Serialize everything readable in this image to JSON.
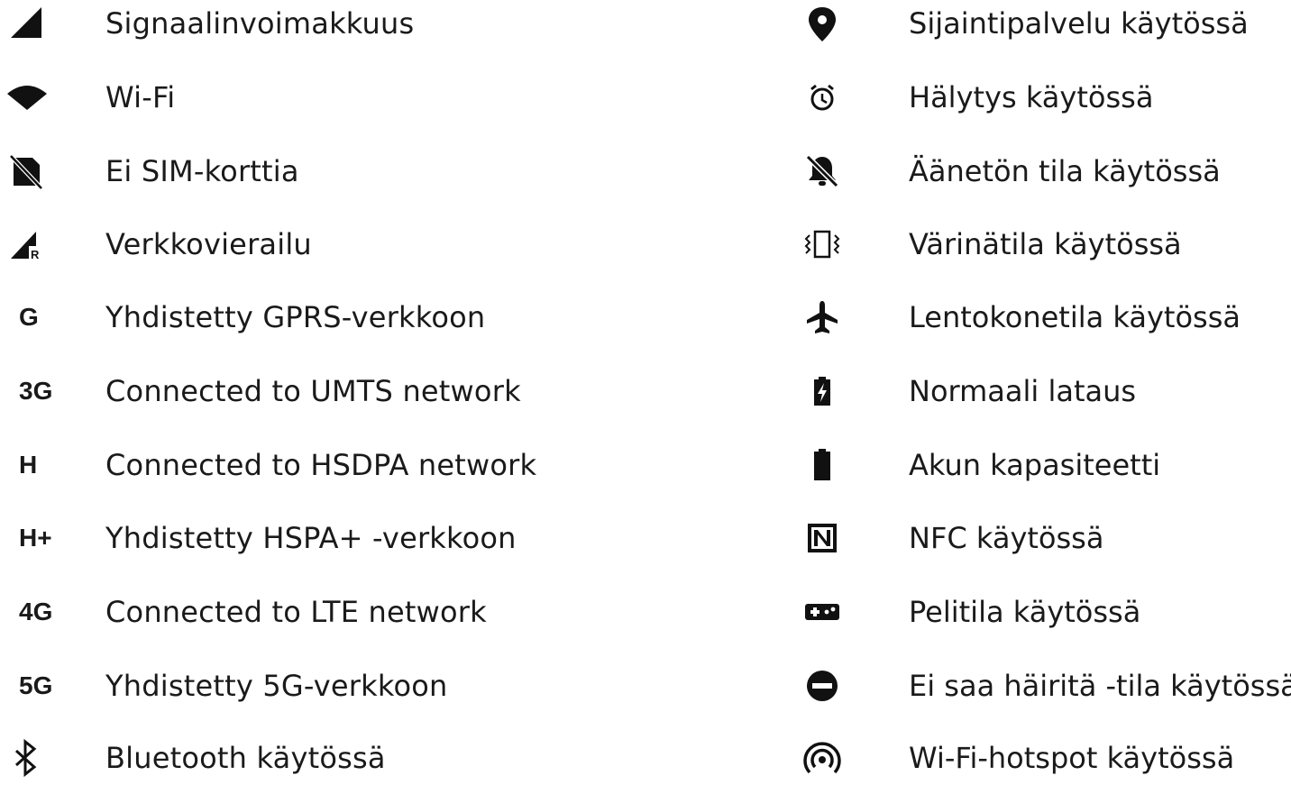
{
  "left_items": [
    {
      "icon": "signal-strength-icon",
      "label": "Signaalinvoimakkuus"
    },
    {
      "icon": "wifi-icon",
      "label": "Wi-Fi"
    },
    {
      "icon": "no-sim-icon",
      "label": "Ei SIM-korttia"
    },
    {
      "icon": "roaming-icon",
      "label": "Verkkovierailu"
    },
    {
      "icon": "gprs-icon",
      "icon_text": "G",
      "label": "Yhdistetty GPRS-verkkoon"
    },
    {
      "icon": "umts-icon",
      "icon_text": "3G",
      "label": "Connected to UMTS network"
    },
    {
      "icon": "hsdpa-icon",
      "icon_text": "H",
      "label": "Connected to HSDPA network"
    },
    {
      "icon": "hspa-plus-icon",
      "icon_text": "H+",
      "label": "Yhdistetty HSPA+ -verkkoon"
    },
    {
      "icon": "lte-icon",
      "icon_text": "4G",
      "label": "Connected to LTE network"
    },
    {
      "icon": "5g-icon",
      "icon_text": "5G",
      "label": "Yhdistetty 5G-verkkoon"
    },
    {
      "icon": "bluetooth-icon",
      "label": "Bluetooth käytössä"
    }
  ],
  "right_items": [
    {
      "icon": "location-icon",
      "label": "Sijaintipalvelu käytössä"
    },
    {
      "icon": "alarm-icon",
      "label": "Hälytys käytössä"
    },
    {
      "icon": "silent-bell-icon",
      "label": "Äänetön tila käytössä"
    },
    {
      "icon": "vibrate-icon",
      "label": "Värinätila käytössä"
    },
    {
      "icon": "airplane-icon",
      "label": "Lentokonetila käytössä"
    },
    {
      "icon": "battery-charging-icon",
      "label": "Normaali lataus"
    },
    {
      "icon": "battery-full-icon",
      "label": "Akun kapasiteetti"
    },
    {
      "icon": "nfc-icon",
      "label": "NFC käytössä"
    },
    {
      "icon": "game-mode-icon",
      "label": "Pelitila käytössä"
    },
    {
      "icon": "do-not-disturb-icon",
      "label": "Ei saa häiritä -tila käytössä"
    },
    {
      "icon": "hotspot-icon",
      "label": "Wi-Fi-hotspot käytössä"
    }
  ]
}
